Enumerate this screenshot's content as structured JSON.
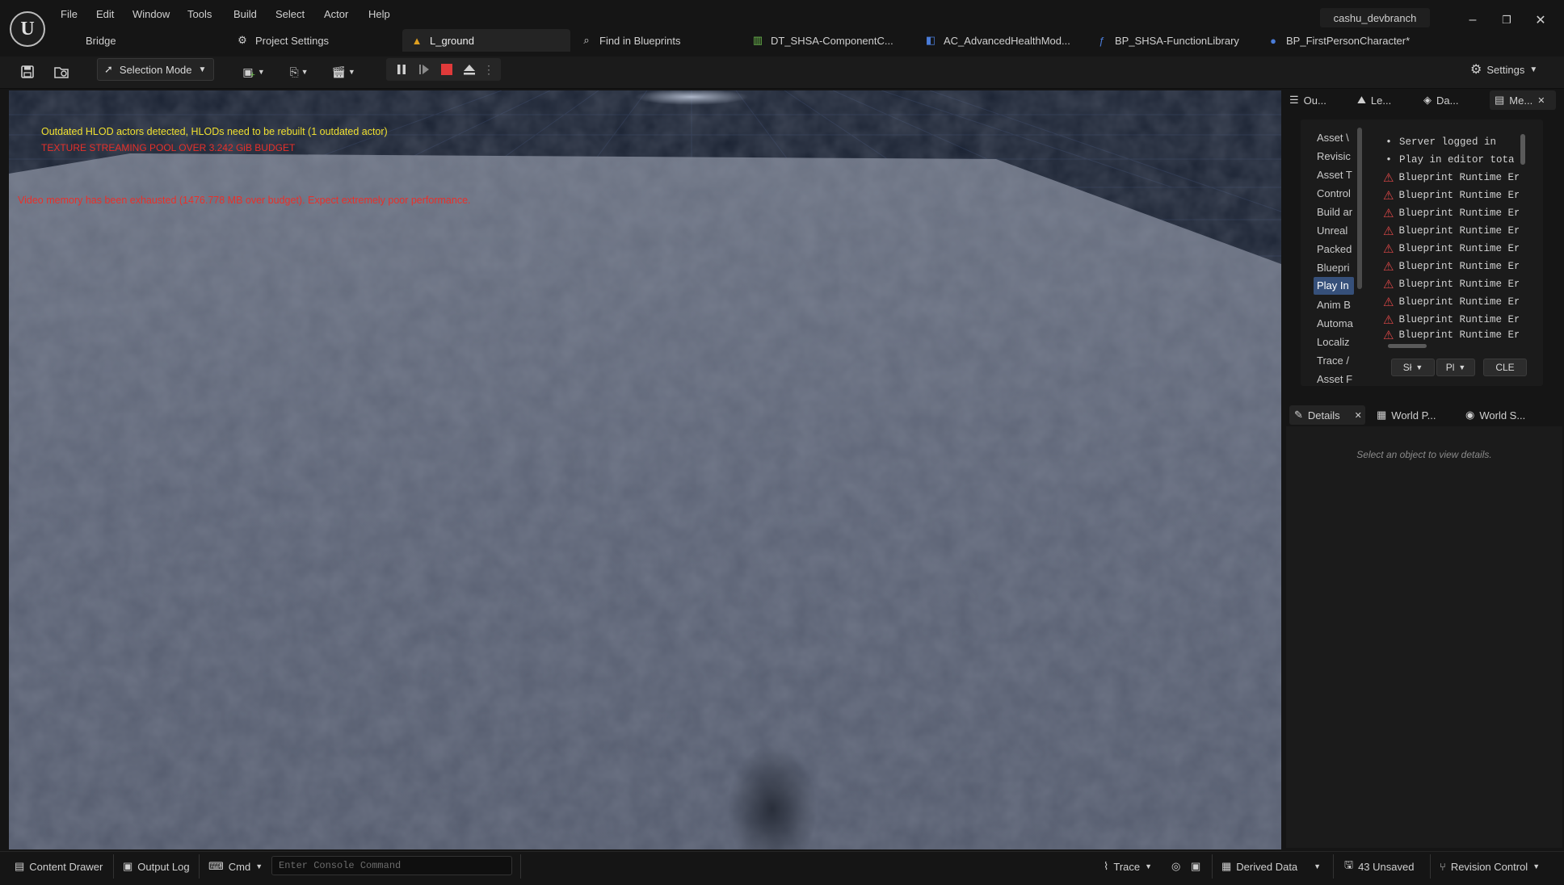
{
  "app": {
    "logo_text": "U",
    "menu": [
      "File",
      "Edit",
      "Window",
      "Tools",
      "Build",
      "Select",
      "Actor",
      "Help"
    ],
    "project_name": "cashu_devbranch",
    "window_controls": {
      "minimize": "–",
      "restore": "❐",
      "close": "✕"
    }
  },
  "tabs": [
    {
      "label": "Bridge",
      "icon": "none"
    },
    {
      "label": "Project Settings",
      "icon": "gear-icon"
    },
    {
      "label": "L_ground",
      "icon": "level-icon",
      "active": true
    },
    {
      "label": "Find in Blueprints",
      "icon": "search-icon"
    },
    {
      "label": "DT_SHSA-ComponentC...",
      "icon": "datatable-icon"
    },
    {
      "label": "AC_AdvancedHealthMod...",
      "icon": "component-icon"
    },
    {
      "label": "BP_SHSA-FunctionLibrary",
      "icon": "function-icon"
    },
    {
      "label": "BP_FirstPersonCharacter*",
      "icon": "character-icon"
    }
  ],
  "toolbar": {
    "mode_label": "Selection Mode",
    "settings_label": "Settings"
  },
  "viewport": {
    "messages": [
      {
        "text": "Outdated HLOD actors detected, HLODs need to be rebuilt (1 outdated actor)",
        "color": "#f0e030"
      },
      {
        "text": "TEXTURE STREAMING POOL OVER 3.242 GiB BUDGET",
        "color": "#e8302a"
      },
      {
        "text": "Video memory has been exhausted (1476.778 MB over budget). Expect extremely poor performance.",
        "color": "#e8302a"
      }
    ]
  },
  "panels": {
    "top_tabs": [
      {
        "label": "Ou...",
        "icon": "outliner-icon"
      },
      {
        "label": "Le...",
        "icon": "levels-icon"
      },
      {
        "label": "Da...",
        "icon": "layers-icon"
      },
      {
        "label": "Me...",
        "icon": "message-log-icon",
        "closable": true
      }
    ],
    "message_log": {
      "categories": [
        "Asset \\",
        "Revisic",
        "Asset T",
        "Control",
        "Build ar",
        "Unreal",
        "Packed",
        "Bluepri",
        "Play In",
        "Anim B",
        "Automa",
        "Localiz",
        "Trace /",
        "Asset F"
      ],
      "selected_category": "Play In",
      "lines": [
        {
          "text": "Server logged in",
          "type": "info"
        },
        {
          "text": "Play in editor tota",
          "type": "info"
        },
        {
          "text": "Blueprint Runtime Er",
          "type": "error"
        },
        {
          "text": "Blueprint Runtime Er",
          "type": "error"
        },
        {
          "text": "Blueprint Runtime Er",
          "type": "error"
        },
        {
          "text": "Blueprint Runtime Er",
          "type": "error"
        },
        {
          "text": "Blueprint Runtime Er",
          "type": "error"
        },
        {
          "text": "Blueprint Runtime Er",
          "type": "error"
        },
        {
          "text": "Blueprint Runtime Er",
          "type": "error"
        },
        {
          "text": "Blueprint Runtime Er",
          "type": "error"
        },
        {
          "text": "Blueprint Runtime Er",
          "type": "error"
        },
        {
          "text": "Blueprint Runtime Er",
          "type": "error"
        }
      ],
      "buttons": {
        "show": "Sł",
        "page": "Pl",
        "clear": "CLE"
      }
    },
    "bottom_tabs": [
      {
        "label": "Details",
        "icon": "details-icon",
        "closable": true
      },
      {
        "label": "World P...",
        "icon": "world-partition-icon"
      },
      {
        "label": "World S...",
        "icon": "world-settings-icon"
      }
    ],
    "details_hint": "Select an object to view details."
  },
  "statusbar": {
    "content_drawer": "Content Drawer",
    "output_log": "Output Log",
    "cmd": "Cmd",
    "console_placeholder": "Enter Console Command",
    "trace": "Trace",
    "derived_data": "Derived Data",
    "unsaved": "43 Unsaved",
    "revision_control": "Revision Control"
  }
}
